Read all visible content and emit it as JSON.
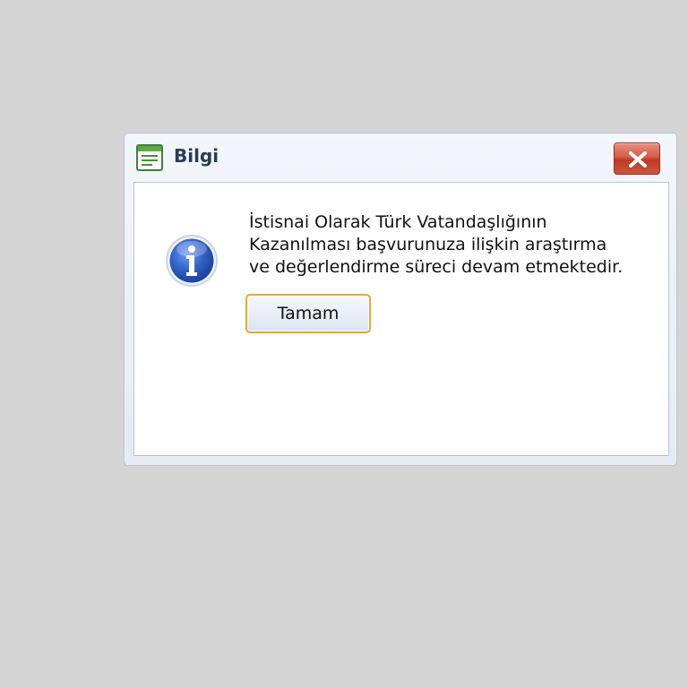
{
  "dialog": {
    "title": "Bilgi",
    "title_icon": "window-list-icon",
    "close_icon": "close-icon",
    "info_icon": "info-icon",
    "message_lines": [
      "İstisnai Olarak Türk Vatandaşlığının",
      "Kazanılması başvurunuza ilişkin araştırma",
      "ve değerlendirme süreci devam etmektedir."
    ],
    "ok_label": "Tamam"
  },
  "colors": {
    "background": "#d4d4d4",
    "close_button": "#d0513c",
    "ok_button_border": "#e0a93a",
    "info_icon": "#2f5fc4"
  }
}
